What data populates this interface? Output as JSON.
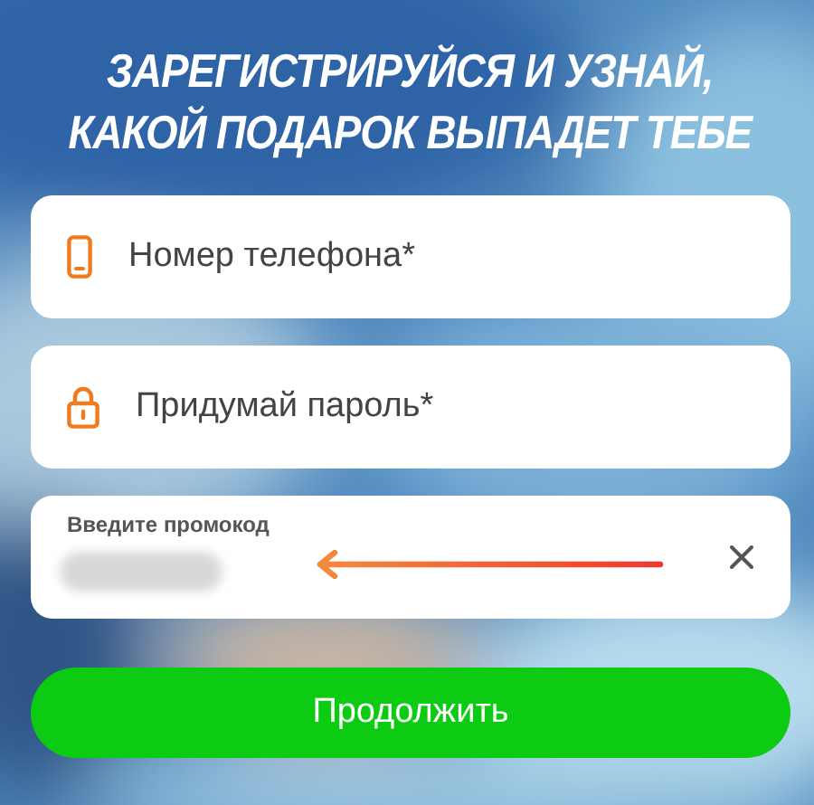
{
  "heading": {
    "lines": [
      "ЗАРЕГИСТРИРУЙСЯ И УЗНАЙ,",
      "КАКОЙ ПОДАРОК ВЫПАДЕТ ТЕБЕ"
    ]
  },
  "fields": [
    {
      "kind": "phone",
      "placeholder": "Номер телефона*"
    },
    {
      "kind": "password",
      "placeholder": "Придумай пароль*"
    },
    {
      "kind": "promo",
      "label": "Введите промокод",
      "value_hidden": true
    }
  ],
  "submit_button": {
    "label": "Продолжить"
  }
}
